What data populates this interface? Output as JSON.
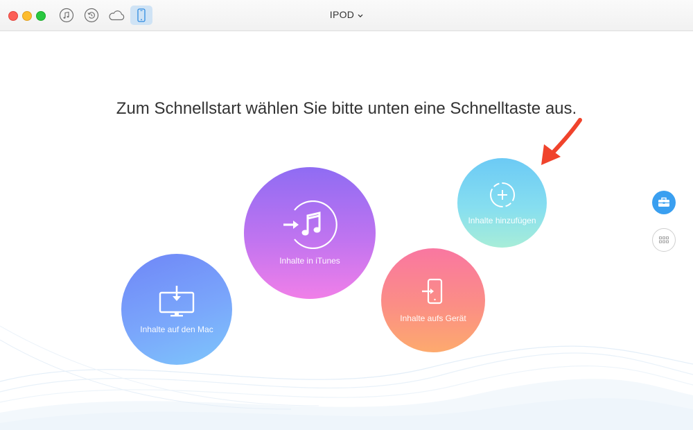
{
  "window": {
    "title": "IPOD",
    "title_chevron": "chevron-down-icon"
  },
  "toolbar": {
    "buttons": [
      {
        "name": "music",
        "icon": "music-note-icon"
      },
      {
        "name": "restore",
        "icon": "restore-icon"
      },
      {
        "name": "cloud",
        "icon": "cloud-icon"
      },
      {
        "name": "device",
        "icon": "iphone-icon",
        "active": true
      }
    ]
  },
  "main": {
    "heading": "Zum Schnellstart wählen Sie bitte unten eine Schnelltaste aus.",
    "shortcuts": {
      "mac": {
        "label": "Inhalte auf den Mac",
        "icon": "monitor-download-icon"
      },
      "itunes": {
        "label": "Inhalte in iTunes",
        "icon": "itunes-transfer-icon"
      },
      "device": {
        "label": "Inhalte aufs Gerät",
        "icon": "phone-import-icon"
      },
      "add": {
        "label": "Inhalte hinzufügen",
        "icon": "add-circle-icon"
      }
    }
  },
  "sidebar": {
    "buttons": [
      {
        "name": "toolbox",
        "icon": "toolbox-icon",
        "active": true
      },
      {
        "name": "grid",
        "icon": "grid-icon"
      }
    ]
  },
  "annotation": {
    "icon": "red-arrow-icon"
  },
  "colors": {
    "accent": "#3a9ff0",
    "arrow": "#f0432c"
  }
}
